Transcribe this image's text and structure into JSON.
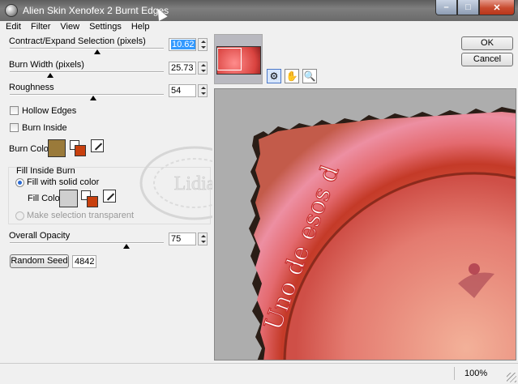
{
  "window": {
    "title": "Alien Skin Xenofex 2 Burnt Edges",
    "controls": {
      "minimize": "–",
      "maximize": "□",
      "close": "✕"
    }
  },
  "menu": [
    "Edit",
    "Filter",
    "View",
    "Settings",
    "Help"
  ],
  "params": {
    "contract_label": "Contract/Expand Selection (pixels)",
    "contract_value": "10.62",
    "burn_width_label": "Burn Width (pixels)",
    "burn_width_value": "25.73",
    "roughness_label": "Roughness",
    "roughness_value": "54",
    "hollow_edges_label": "Hollow Edges",
    "burn_inside_label": "Burn Inside",
    "burn_color_label": "Burn Color",
    "burn_color": "#9a7a3a",
    "fill_inside_label": "Fill Inside Burn",
    "fill_solid_label": "Fill with solid color",
    "fill_color_label": "Fill Color",
    "fill_color": "#cfcfcf",
    "make_transparent_label": "Make selection transparent",
    "opacity_label": "Overall Opacity",
    "opacity_value": "75",
    "random_seed_button": "Random Seed",
    "random_seed_value": "4842"
  },
  "actions": {
    "ok": "OK",
    "cancel": "Cancel"
  },
  "tools": [
    "compare-icon",
    "hand-icon",
    "zoom-icon"
  ],
  "preview": {
    "text": "Uno de esos d"
  },
  "watermark": "Lidia",
  "status": {
    "zoom": "100%"
  }
}
